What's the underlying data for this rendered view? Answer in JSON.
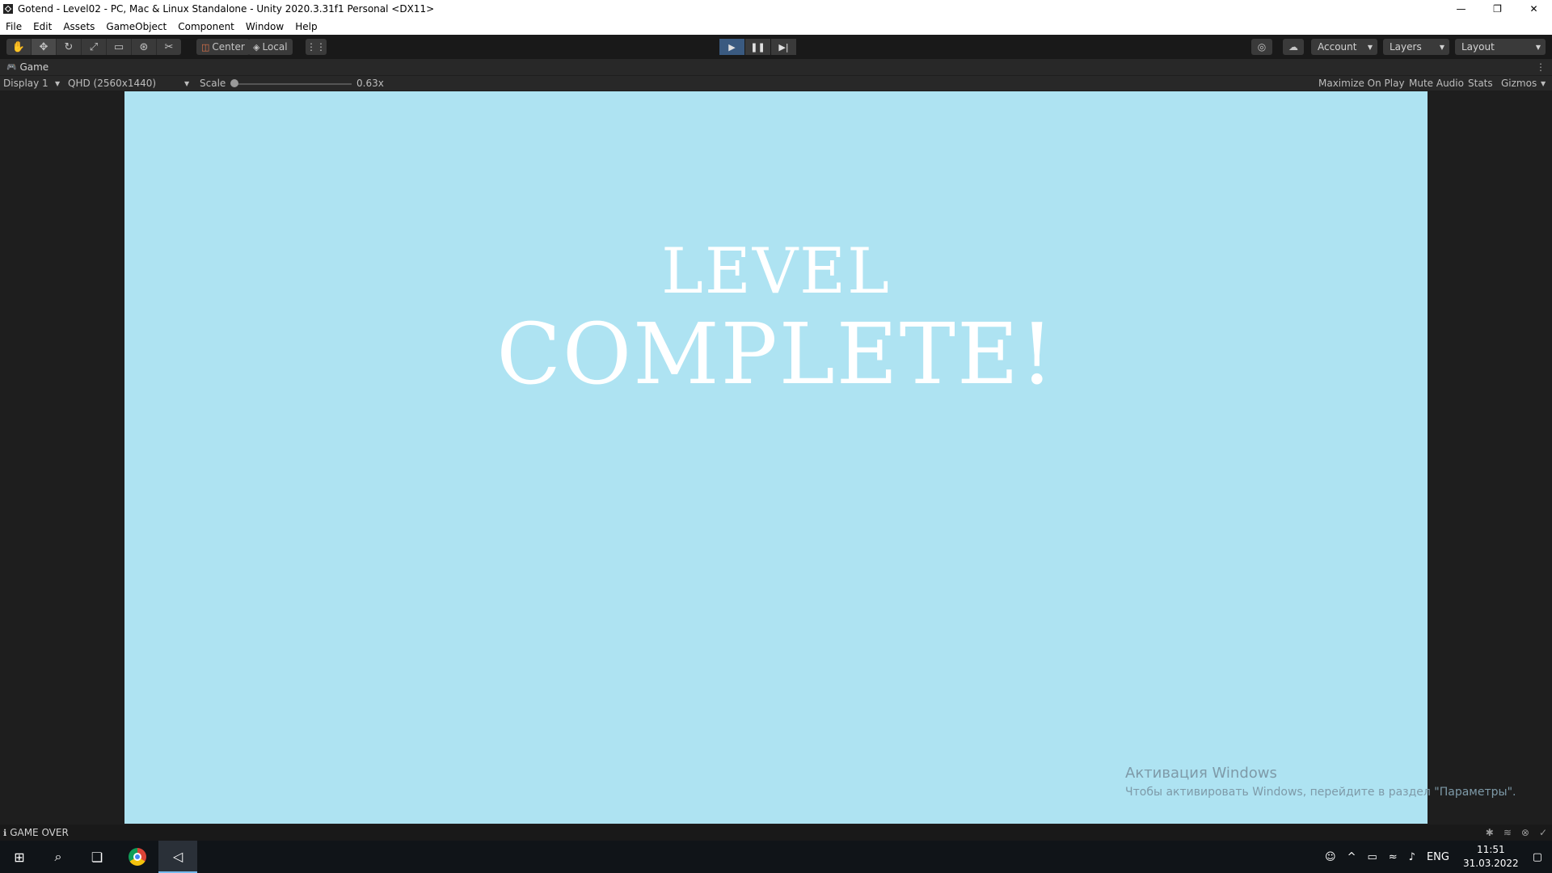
{
  "window": {
    "title": "Gotend - Level02 - PC, Mac & Linux Standalone - Unity 2020.3.31f1 Personal <DX11>",
    "controls": {
      "minimize": "—",
      "restore": "❐",
      "close": "✕"
    }
  },
  "menu": [
    "File",
    "Edit",
    "Assets",
    "GameObject",
    "Component",
    "Window",
    "Help"
  ],
  "toolbar": {
    "tools": [
      "hand-icon",
      "move-icon",
      "rotate-icon",
      "scale-icon",
      "rect-icon",
      "transform-icon",
      "custom-tool-icon"
    ],
    "pivot_mode": "Center",
    "pivot_rotation": "Local",
    "account_label": "Account",
    "layers_label": "Layers",
    "layout_label": "Layout"
  },
  "game_view": {
    "tab_label": "Game",
    "display": "Display 1",
    "resolution": "QHD (2560x1440)",
    "scale_label": "Scale",
    "scale_value": "0.63x",
    "maximize_on_play": "Maximize On Play",
    "mute_audio": "Mute Audio",
    "stats": "Stats",
    "gizmos": "Gizmos"
  },
  "game_screen": {
    "line1": "LEVEL",
    "line2": "COMPLETE!",
    "background_color": "#aee3f2"
  },
  "watermark": {
    "title": "Активация Windows",
    "subtitle": "Чтобы активировать Windows, перейдите в раздел \"Параметры\"."
  },
  "status": {
    "message": "GAME OVER"
  },
  "taskbar": {
    "language": "ENG",
    "time": "11:51",
    "date": "31.03.2022"
  }
}
